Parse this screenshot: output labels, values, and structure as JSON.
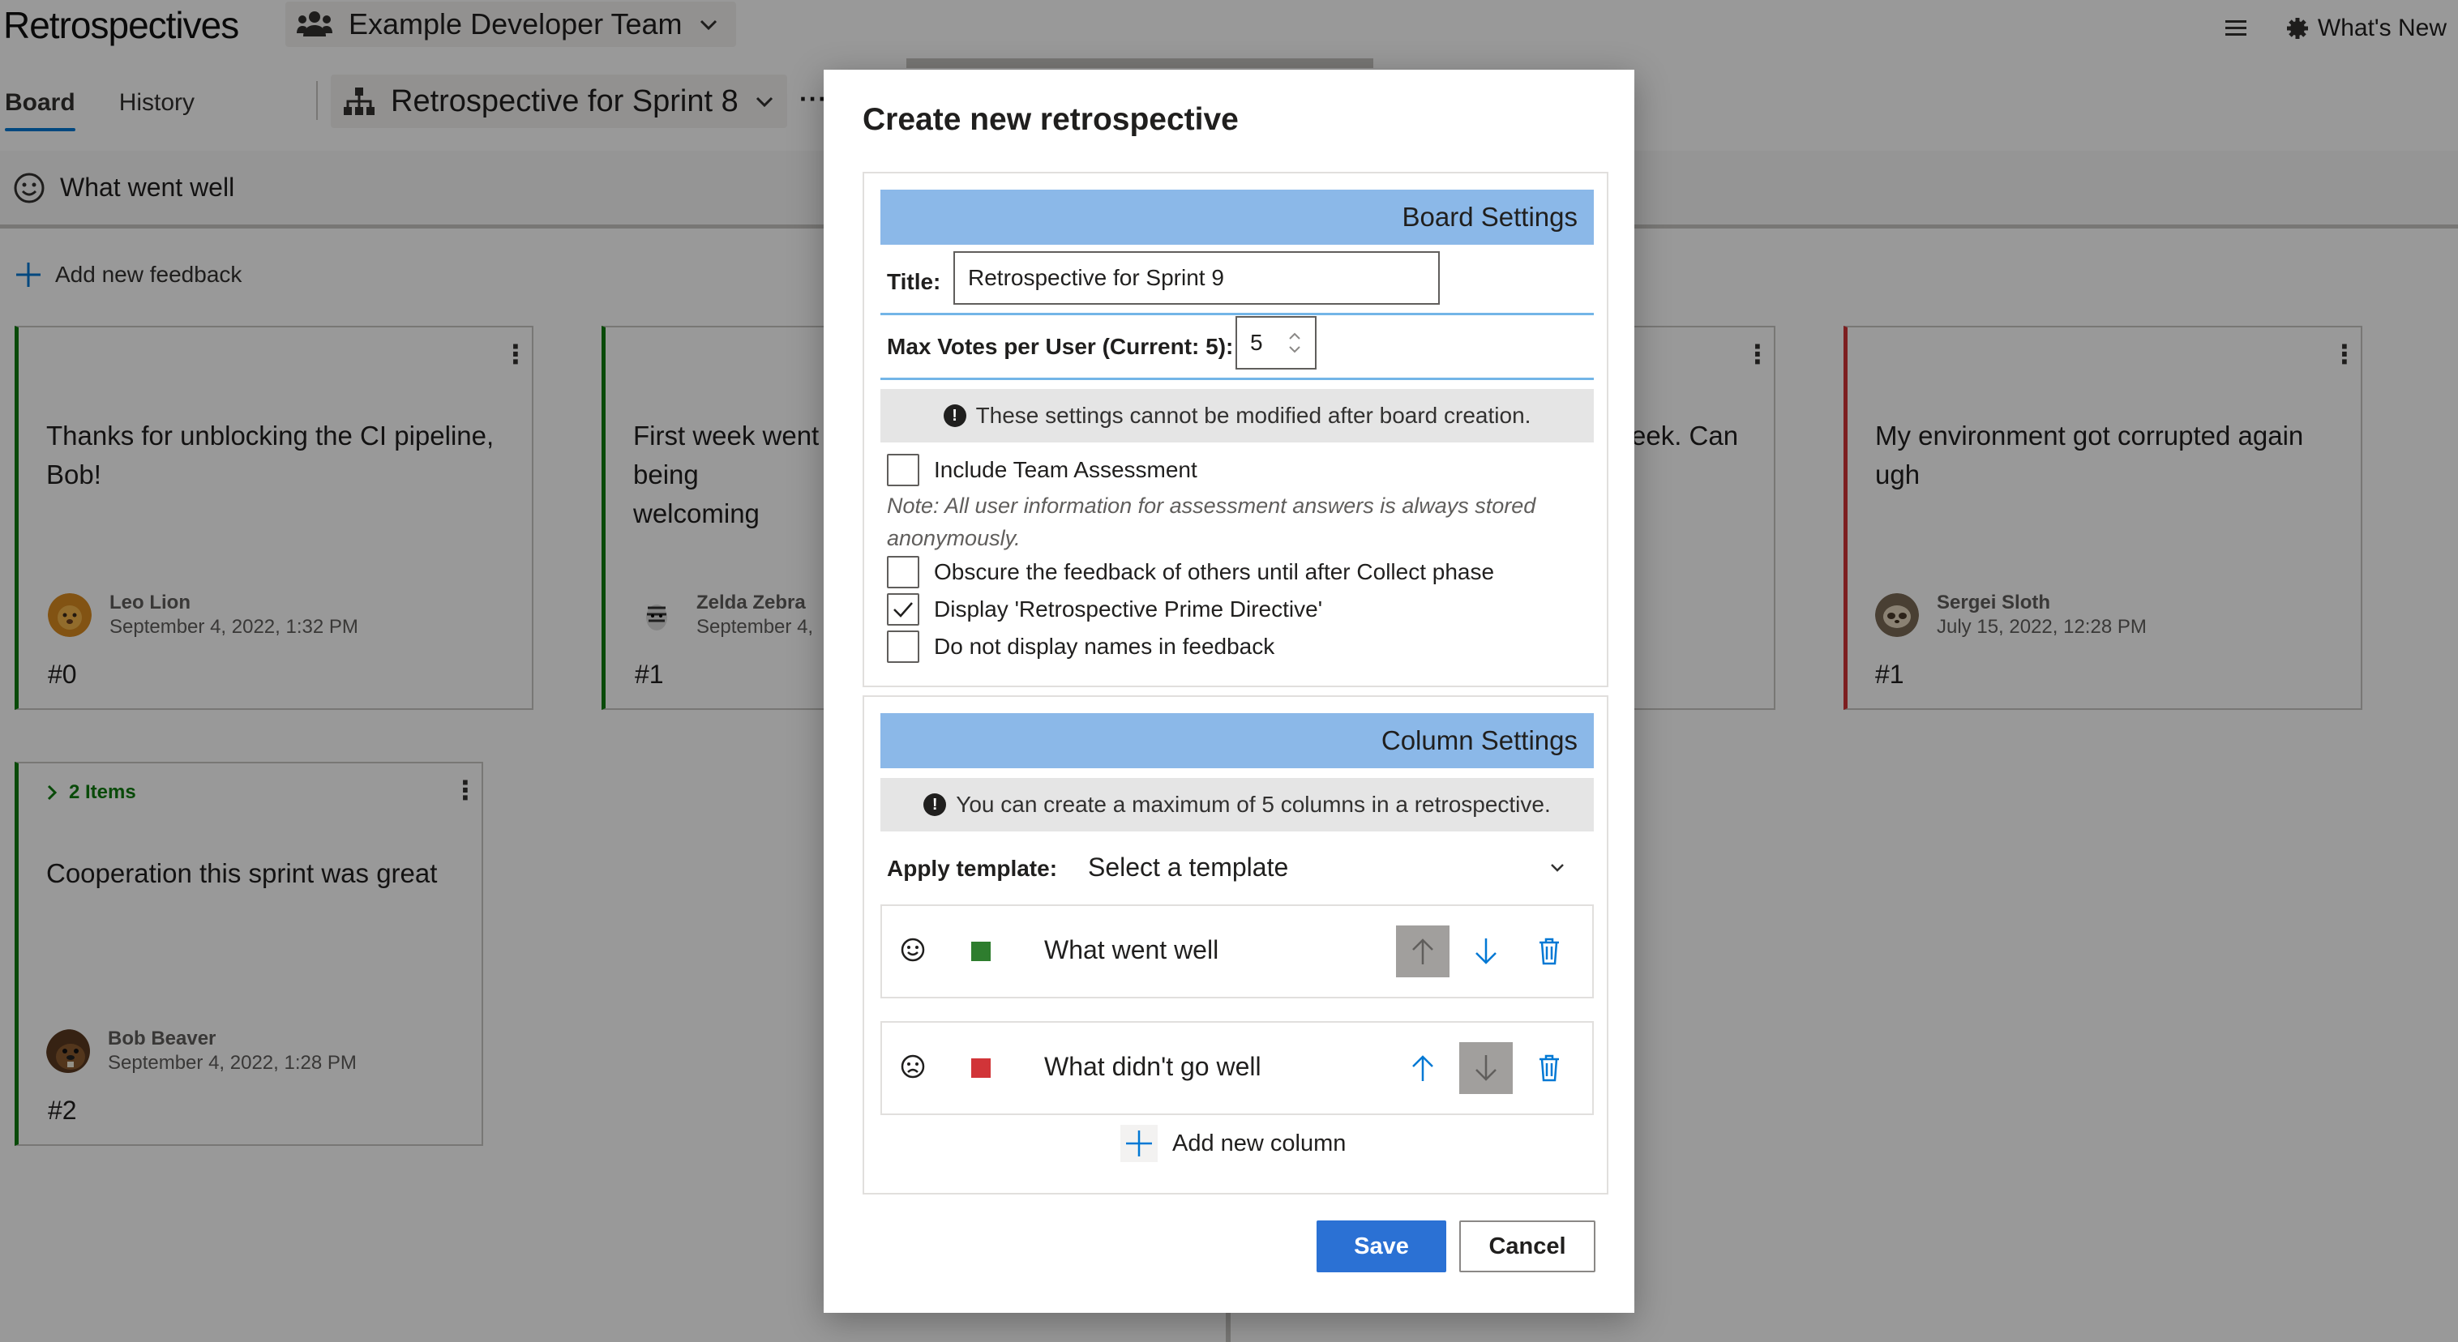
{
  "app": {
    "title": "Retrospectives",
    "team": "Example Developer Team",
    "menu_icon": "hamburger-icon",
    "whats_new": "What's New",
    "tabs": [
      "Board",
      "History"
    ],
    "board_name": "Retrospective for Sprint 8",
    "more": "···",
    "column_header": "What went well",
    "add_feedback": "Add new feedback",
    "cards": [
      {
        "text": "Thanks for unblocking the CI pipeline, Bob!",
        "author": "Leo Lion",
        "date": "September 4, 2022, 1:32 PM",
        "number": "#0"
      },
      {
        "text": "First week went being welcoming",
        "author": "Zelda Zebra",
        "date": "September 4,",
        "number": "#1"
      },
      {
        "text": "eek. Can"
      },
      {
        "text": "My environment got corrupted again ugh",
        "author": "Sergei Sloth",
        "date": "July 15, 2022, 12:28 PM",
        "number": "#1"
      },
      {
        "group": "2 Items",
        "text": "Cooperation this sprint was great",
        "author": "Bob Beaver",
        "date": "September 4, 2022, 1:28 PM",
        "number": "#2"
      }
    ]
  },
  "dialog": {
    "title": "Create new retrospective",
    "board_settings": {
      "header": "Board Settings",
      "title_label": "Title:",
      "title_value": "Retrospective for Sprint 9",
      "max_votes_label": "Max Votes per User (Current: 5):",
      "max_votes_value": "5",
      "info": "These settings cannot be modified after board creation.",
      "checkboxes": [
        {
          "label": "Include Team Assessment",
          "checked": false
        },
        {
          "label": "Obscure the feedback of others until after Collect phase",
          "checked": false
        },
        {
          "label": "Display 'Retrospective Prime Directive'",
          "checked": true
        },
        {
          "label": "Do not display names in feedback",
          "checked": false
        }
      ],
      "note": "Note: All user information for assessment answers is always stored anonymously."
    },
    "column_settings": {
      "header": "Column Settings",
      "info": "You can create a maximum of 5 columns in a retrospective.",
      "template_label": "Apply template:",
      "template_value": "Select a template",
      "columns": [
        {
          "name": "What went well",
          "icon": "smile-icon",
          "color": "#2e7d2e"
        },
        {
          "name": "What didn't go well",
          "icon": "frown-icon",
          "color": "#d13438"
        }
      ],
      "add_column": "Add new column"
    },
    "save": "Save",
    "cancel": "Cancel"
  },
  "colors": {
    "accent": "#0078d4",
    "primary_button": "#2b71d4",
    "section_header": "#8bb8e8"
  }
}
